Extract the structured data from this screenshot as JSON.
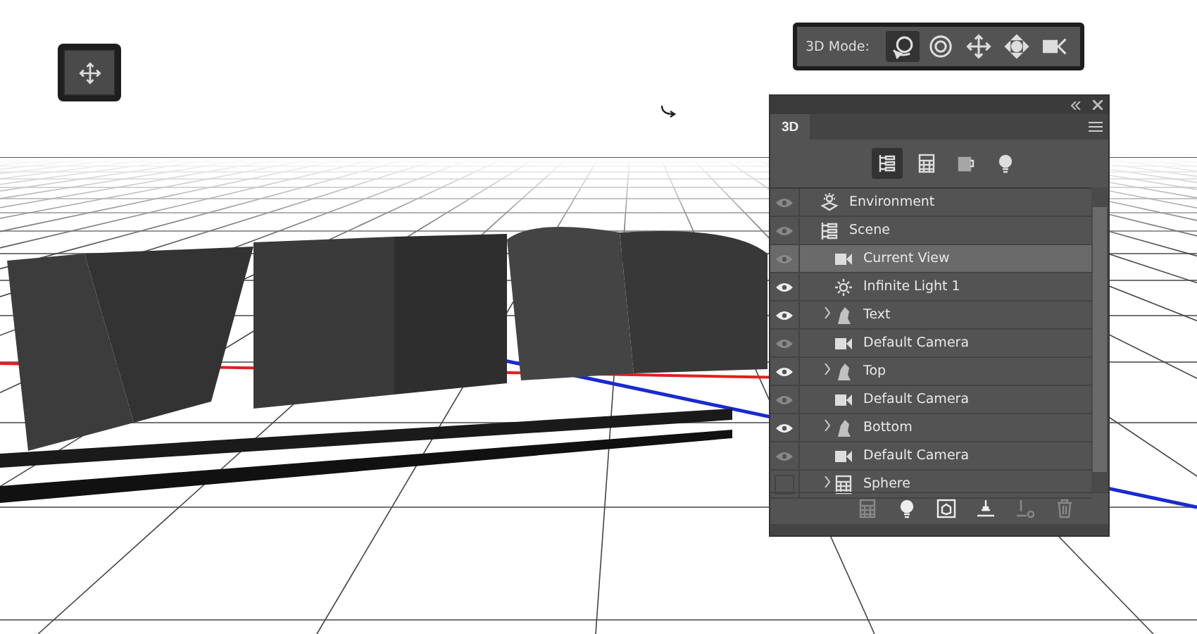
{
  "mode_bar": {
    "label": "3D Mode:",
    "modes": [
      {
        "kind": "orbit",
        "selected": true
      },
      {
        "kind": "roll",
        "selected": false
      },
      {
        "kind": "drag",
        "selected": false
      },
      {
        "kind": "slide",
        "selected": false
      },
      {
        "kind": "zoom",
        "selected": false
      }
    ]
  },
  "panel": {
    "tab": "3D",
    "filters": [
      {
        "kind": "scene",
        "selected": true
      },
      {
        "kind": "mesh",
        "selected": false
      },
      {
        "kind": "material",
        "selected": false
      },
      {
        "kind": "light",
        "selected": false
      }
    ],
    "layers": [
      {
        "label": "Environment",
        "kind": "environment",
        "visible": false,
        "selected": false
      },
      {
        "label": "Scene",
        "kind": "scene",
        "visible": false,
        "selected": false,
        "children": [
          {
            "label": "Current View",
            "kind": "camera",
            "visible": false,
            "selected": true
          },
          {
            "label": "Infinite Light 1",
            "kind": "light",
            "visible": true,
            "selected": false
          },
          {
            "label": "Text",
            "kind": "mesh",
            "visible": true,
            "selected": false,
            "expanded": false
          },
          {
            "label": "Default Camera",
            "kind": "camera",
            "visible": false,
            "selected": false
          },
          {
            "label": "Top",
            "kind": "mesh",
            "visible": true,
            "selected": false,
            "expanded": false
          },
          {
            "label": "Default Camera",
            "kind": "camera",
            "visible": false,
            "selected": false
          },
          {
            "label": "Bottom",
            "kind": "mesh",
            "visible": true,
            "selected": false,
            "expanded": false
          },
          {
            "label": "Default Camera",
            "kind": "camera",
            "visible": false,
            "selected": false
          },
          {
            "label": "Sphere",
            "kind": "primitive",
            "selected": false,
            "expanded": false
          }
        ]
      }
    ],
    "toolbar": [
      {
        "kind": "new-mesh",
        "disabled": true
      },
      {
        "kind": "new-light",
        "disabled": false
      },
      {
        "kind": "render",
        "disabled": false
      },
      {
        "kind": "drop",
        "disabled": false
      },
      {
        "kind": "delete-mesh",
        "disabled": true
      },
      {
        "kind": "delete",
        "disabled": true
      }
    ]
  }
}
